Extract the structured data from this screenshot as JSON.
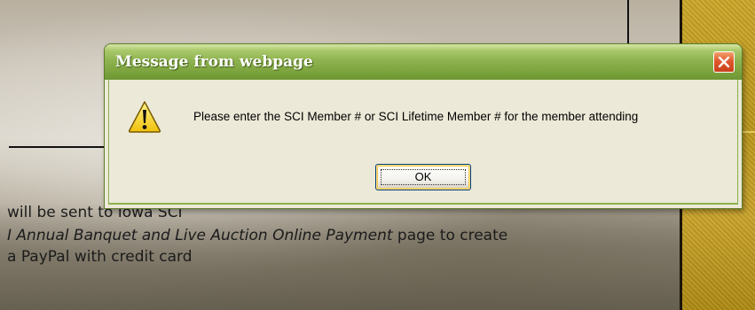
{
  "background_page": {
    "lines": [
      {
        "text": "will be sent to Iowa SCI"
      },
      {
        "italic": "I Annual Banquet and Live Auction Online Payment",
        "rest": " page to create"
      },
      {
        "text": "a PayPal with credit card"
      }
    ]
  },
  "dialog": {
    "title": "Message from webpage",
    "message": "Please enter the SCI Member # or SCI Lifetime Member # for the member attending",
    "ok_label": "OK",
    "icon": "warning-icon",
    "close_icon": "close-icon"
  },
  "colors": {
    "titlebar": "#8fb350",
    "dialog_body": "#ece9d8",
    "close_button": "#e0582c",
    "side_panel": "#c9a52c"
  }
}
